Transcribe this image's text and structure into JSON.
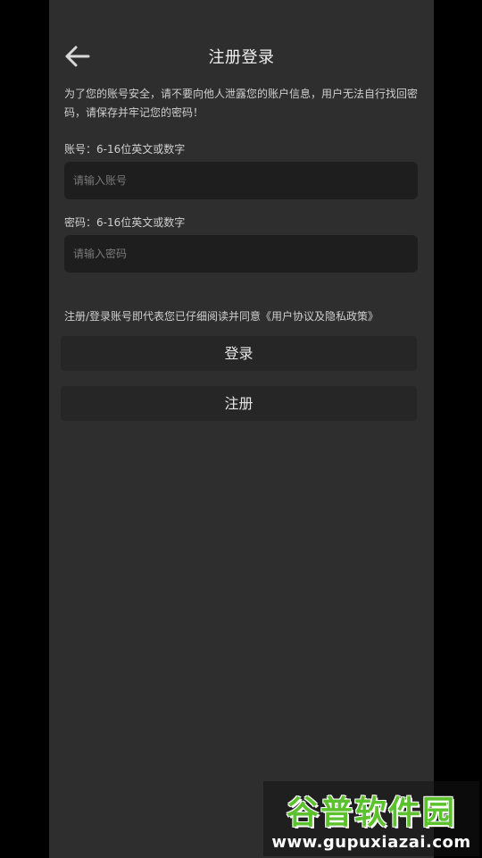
{
  "header": {
    "back_icon": "arrow-left-icon",
    "title": "注册登录"
  },
  "notice": "为了您的账号安全，请不要向他人泄露您的账户信息，用户无法自行找回密码，请保存并牢记您的密码！",
  "account": {
    "label": "账号：6-16位英文或数字",
    "placeholder": "请输入账号",
    "value": ""
  },
  "password": {
    "label": "密码：6-16位英文或数字",
    "placeholder": "请输入密码",
    "value": ""
  },
  "agreement": "注册/登录账号即代表您已仔细阅读并同意《用户协议及隐私政策》",
  "buttons": {
    "login": "登录",
    "register": "注册"
  },
  "watermark": {
    "title": "谷普软件园",
    "url": "www.gupuxiazai.com"
  },
  "colors": {
    "background": "#2e2e2e",
    "input_bg": "#1e1e1e",
    "button_bg": "#262626",
    "text": "#f0f0f0",
    "watermark_green": "#5bc12d"
  }
}
